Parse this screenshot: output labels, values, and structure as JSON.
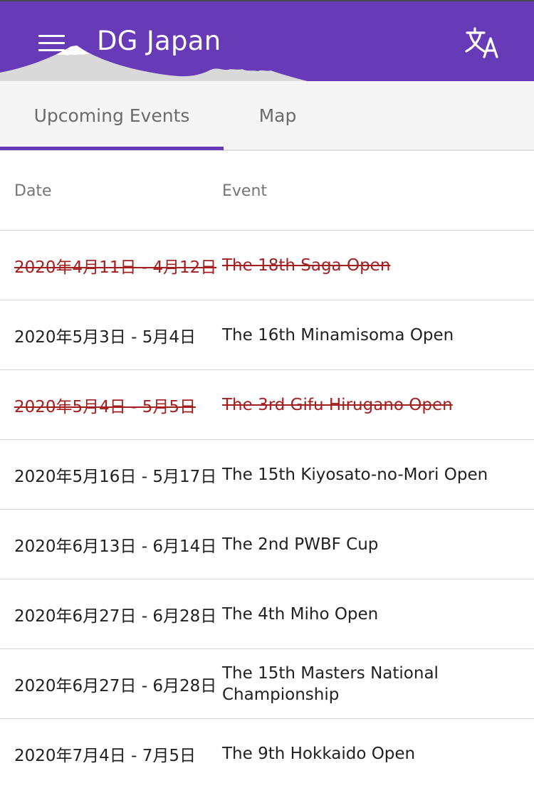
{
  "app_bar": {
    "title": "DG Japan",
    "menu_icon": "hamburger-menu-icon",
    "translate_icon": "translate-icon",
    "color": "#673ab7"
  },
  "tabs": [
    {
      "label": "Upcoming Events",
      "active": true
    },
    {
      "label": "Map",
      "active": false
    }
  ],
  "table": {
    "headers": {
      "date": "Date",
      "event": "Event"
    },
    "rows": [
      {
        "date": "2020年4月11日 - 4月12日",
        "event": "The 18th Saga Open",
        "cancelled": true
      },
      {
        "date": "2020年5月3日 - 5月4日",
        "event": "The 16th Minamisoma Open",
        "cancelled": false
      },
      {
        "date": "2020年5月4日 - 5月5日",
        "event": "The 3rd Gifu Hirugano Open",
        "cancelled": true
      },
      {
        "date": "2020年5月16日 - 5月17日",
        "event": "The 15th Kiyosato-no-Mori Open",
        "cancelled": false
      },
      {
        "date": "2020年6月13日 - 6月14日",
        "event": "The 2nd PWBF Cup",
        "cancelled": false
      },
      {
        "date": "2020年6月27日 - 6月28日",
        "event": "The 4th Miho Open",
        "cancelled": false
      },
      {
        "date": "2020年6月27日 - 6月28日",
        "event": "The 15th Masters National Championship",
        "cancelled": false
      },
      {
        "date": "2020年7月4日 - 7月5日",
        "event": "The 9th Hokkaido Open",
        "cancelled": false
      }
    ]
  },
  "colors": {
    "accent": "#673ab7",
    "cancelled": "#a31f1f"
  }
}
